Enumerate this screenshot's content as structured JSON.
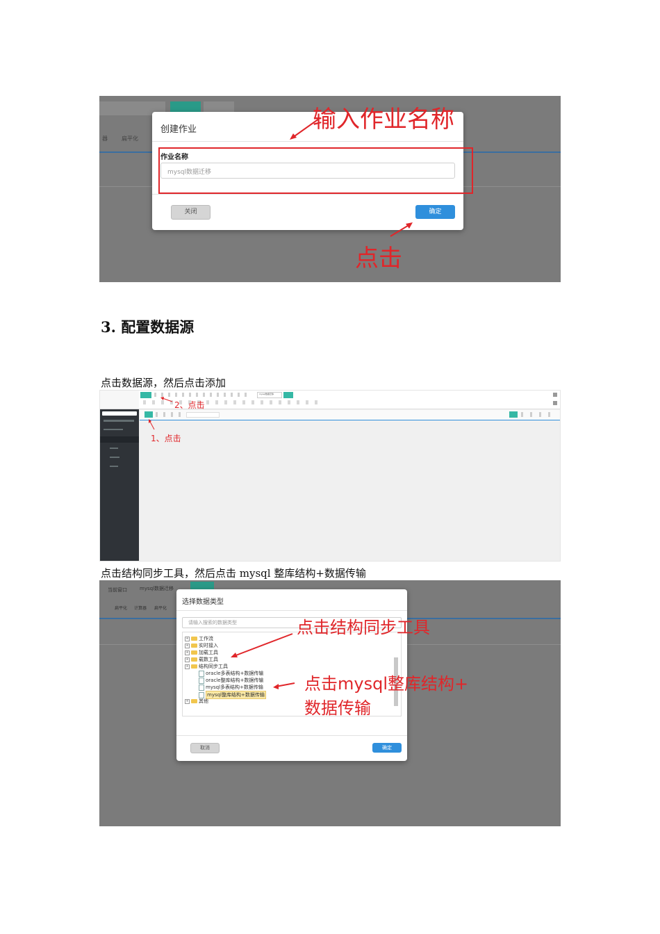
{
  "shot1": {
    "dialog_title": "创建作业",
    "field_label": "作业名称",
    "field_placeholder": "mysql数据迁移",
    "close_button": "关闭",
    "confirm_button": "确定",
    "annotation_top": "输入作业名称",
    "annotation_bottom": "点击",
    "bg_toolbar": [
      "器",
      "扁平化"
    ],
    "colors": {
      "annotation": "#e0262a",
      "confirm": "#2f8fdc"
    }
  },
  "heading": "3. 配置数据源",
  "caption1": "点击数据源，然后点击添加",
  "shot2": {
    "annotation_1": "1、点击",
    "annotation_2": "2、点击",
    "tab_label": "mysql数据迁移"
  },
  "caption2": "点击结构同步工具，然后点击 mysql 整库结构+数据传输",
  "shot3": {
    "window_label": "当前窗口",
    "tab_label": "mysql数据迁移",
    "bg_toolbar": [
      "扁平化",
      "计算器",
      "扁平化"
    ],
    "dialog_title": "选择数据类型",
    "search_placeholder": "请输入搜索的数据类型",
    "tree": [
      {
        "label": "工作流",
        "type": "folder",
        "level": 0
      },
      {
        "label": "实时接入",
        "type": "folder",
        "level": 0
      },
      {
        "label": "加载工具",
        "type": "folder",
        "level": 0
      },
      {
        "label": "载数工具",
        "type": "folder",
        "level": 0
      },
      {
        "label": "结构同步工具",
        "type": "folder",
        "level": 0
      },
      {
        "label": "oracle多表结构+数据传输",
        "type": "doc",
        "level": 1
      },
      {
        "label": "oracle整库结构+数据传输",
        "type": "doc",
        "level": 1
      },
      {
        "label": "mysql多表结构+数据传输",
        "type": "doc",
        "level": 1
      },
      {
        "label": "mysql整库结构+数据传输",
        "type": "doc",
        "level": 1,
        "selected": true
      },
      {
        "label": "其他",
        "type": "folder",
        "level": 0
      }
    ],
    "cancel_button": "取消",
    "confirm_button": "确定",
    "annotation_a": "点击结构同步工具",
    "annotation_b1": "点击mysql整库结构+",
    "annotation_b2": "数据传输"
  }
}
